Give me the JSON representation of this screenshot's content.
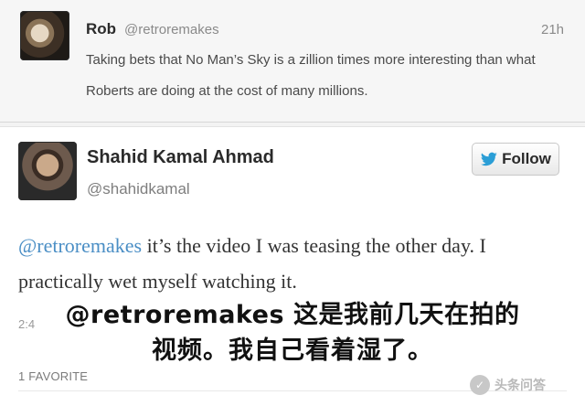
{
  "tweet_top": {
    "name": "Rob",
    "handle": "@retroremakes",
    "time": "21h",
    "text": "Taking bets that No Man’s Sky is a zillion times more interesting than what Roberts are doing at the cost of many millions."
  },
  "tweet_main": {
    "name": "Shahid Kamal Ahmad",
    "handle": "@shahidkamal",
    "follow_label": "Follow",
    "mention": "@retroremakes",
    "text_line1_rest": " it’s the video I was teasing the other day. I",
    "text_line2": "practically wet myself watching it.",
    "timestamp_visible": "2:4",
    "favorites": "1 FAVORITE"
  },
  "overlay": {
    "line1": "@retroremakes 这是我前几天在拍的",
    "line2": "视频。我自己看着湿了。"
  },
  "watermark": {
    "text": "头条问答"
  },
  "icons": [
    "twitter-bird-icon",
    "avatar-rob",
    "avatar-shahid",
    "watermark-logo-icon"
  ],
  "colors": {
    "mention": "#4a8ec5",
    "follow_bird": "#2b9ed6"
  }
}
